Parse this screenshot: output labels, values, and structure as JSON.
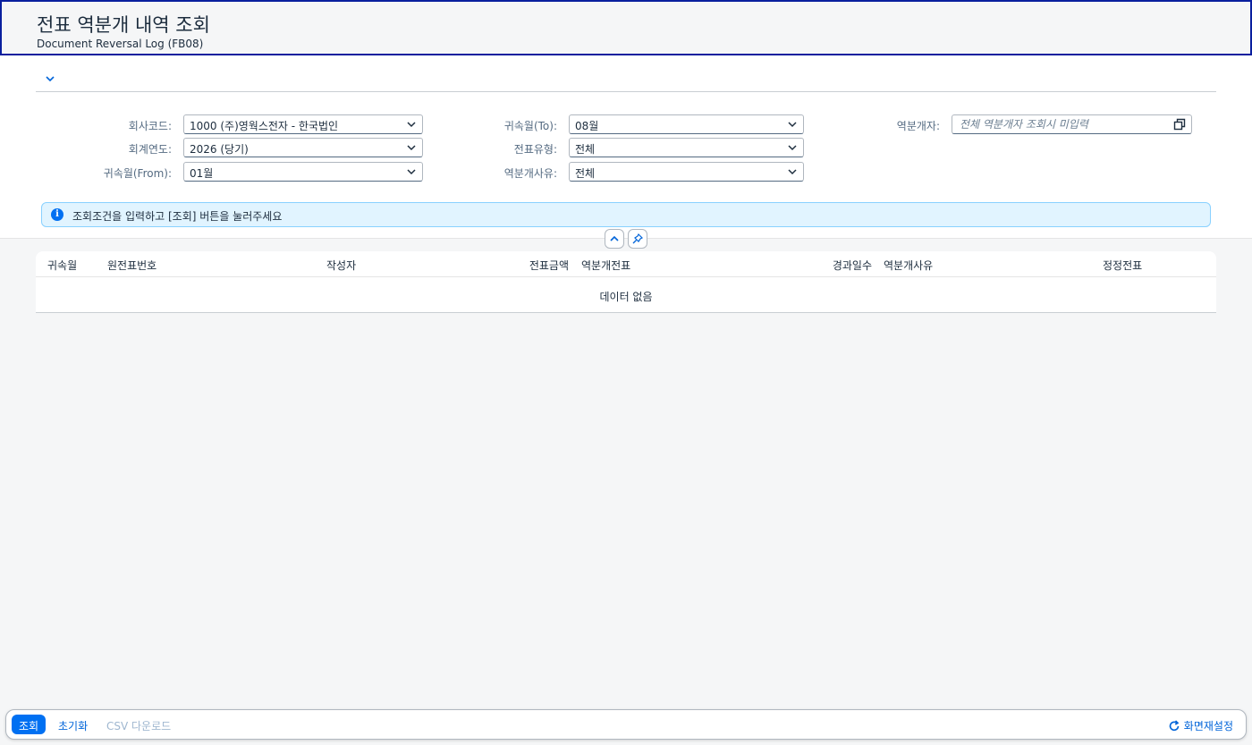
{
  "header": {
    "title": "전표 역분개 내역 조회",
    "subtitle": "Document Reversal Log (FB08)"
  },
  "filters": {
    "company_code": {
      "label": "회사코드:",
      "value": "1000 (주)영웍스전자 - 한국법인"
    },
    "fiscal_year": {
      "label": "회계연도:",
      "value": "2026 (당기)"
    },
    "period_from": {
      "label": "귀속월(From):",
      "value": "01월"
    },
    "period_to": {
      "label": "귀속월(To):",
      "value": "08월"
    },
    "doc_type": {
      "label": "전표유형:",
      "value": "전체"
    },
    "reversal_reason": {
      "label": "역분개사유:",
      "value": "전체"
    },
    "reverser": {
      "label": "역분개자:",
      "placeholder": "전체 역분개자 조회시 미입력"
    }
  },
  "message": {
    "text": "조회조건을 입력하고 [조회] 버튼을 눌러주세요"
  },
  "table": {
    "columns": [
      "귀속월",
      "원전표번호",
      "작성자",
      "전표금액",
      "역분개전표",
      "경과일수",
      "역분개사유",
      "정정전표"
    ],
    "empty_text": "데이터 없음"
  },
  "footer": {
    "search": "조회",
    "reset": "초기화",
    "csv": "CSV 다운로드",
    "reset_layout": "화면재설정"
  },
  "colors": {
    "accent": "#0070f2",
    "header_border": "#0a1f9e",
    "info_bg": "#e1f4ff"
  }
}
